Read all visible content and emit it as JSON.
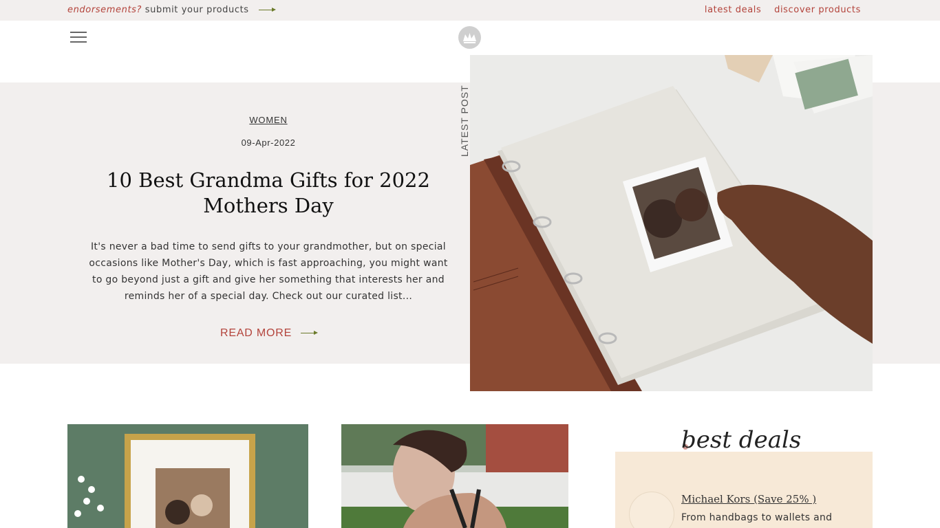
{
  "topbar": {
    "promo_em": "endorsements?",
    "promo_text": "submit your products",
    "links": [
      "latest deals",
      "discover products"
    ]
  },
  "hero": {
    "label": "LATEST POST",
    "category": "WOMEN",
    "date": "09-Apr-2022",
    "title": "10 Best Grandma Gifts for 2022 Mothers Day",
    "excerpt": "It's never a bad time to send gifts to your grandmother, but on special occasions like Mother's Day, which is fast approaching, you might want to go beyond just a gift and give her something that interests her and reminds her of a special day. Check out our curated list...",
    "read_more": "READ MORE"
  },
  "deals": {
    "heading": "best deals",
    "items": [
      {
        "title": "Michael Kors (Save 25% )",
        "desc": "From handbags to wallets and"
      }
    ]
  },
  "colors": {
    "accent": "#b3433b",
    "arrow": "#6b7a2a",
    "hero_bg": "#f2efee",
    "deals_bg": "#f7e9d7"
  },
  "icons": [
    "menu-icon",
    "crown-logo-icon",
    "arrow-right-icon"
  ]
}
